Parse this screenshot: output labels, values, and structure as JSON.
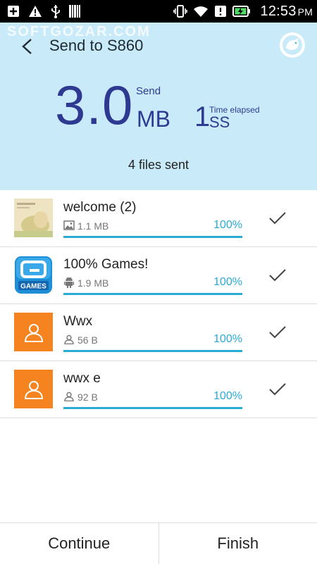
{
  "status_bar": {
    "time": "12:53",
    "ampm": "PM",
    "icons": [
      "add-box-icon",
      "warning-icon",
      "usb-icon",
      "barcode-icon",
      "vibrate-icon",
      "wifi-icon",
      "alert-icon",
      "battery-charging-icon"
    ]
  },
  "header": {
    "watermark": "SOFTGOZAR.COM",
    "title": "Send to S860",
    "size_value": "3.0",
    "size_unit": "MB",
    "send_label": "Send",
    "elapsed_value": "1",
    "elapsed_unit": "SS",
    "elapsed_label": "Time elapsed",
    "files_sent": "4 files sent"
  },
  "files": [
    {
      "name": "welcome (2)",
      "size": "1.1 MB",
      "percent": "100%",
      "progress": 1.0,
      "type": "image",
      "meta_icon": "image-icon"
    },
    {
      "name": "100% Games!",
      "size": "1.9 MB",
      "percent": "100%",
      "progress": 1.0,
      "type": "app",
      "meta_icon": "android-icon",
      "thumb_label": "GAMES"
    },
    {
      "name": "Wwx",
      "size": "56 B",
      "percent": "100%",
      "progress": 1.0,
      "type": "contact",
      "meta_icon": "person-icon"
    },
    {
      "name": "wwx e",
      "size": "92 B",
      "percent": "100%",
      "progress": 1.0,
      "type": "contact",
      "meta_icon": "person-icon"
    }
  ],
  "footer": {
    "continue_label": "Continue",
    "finish_label": "Finish"
  },
  "colors": {
    "header_bg": "#c9ebf9",
    "accent": "#29abd6",
    "primary_text": "#2e3992",
    "contact_orange": "#f58420"
  }
}
